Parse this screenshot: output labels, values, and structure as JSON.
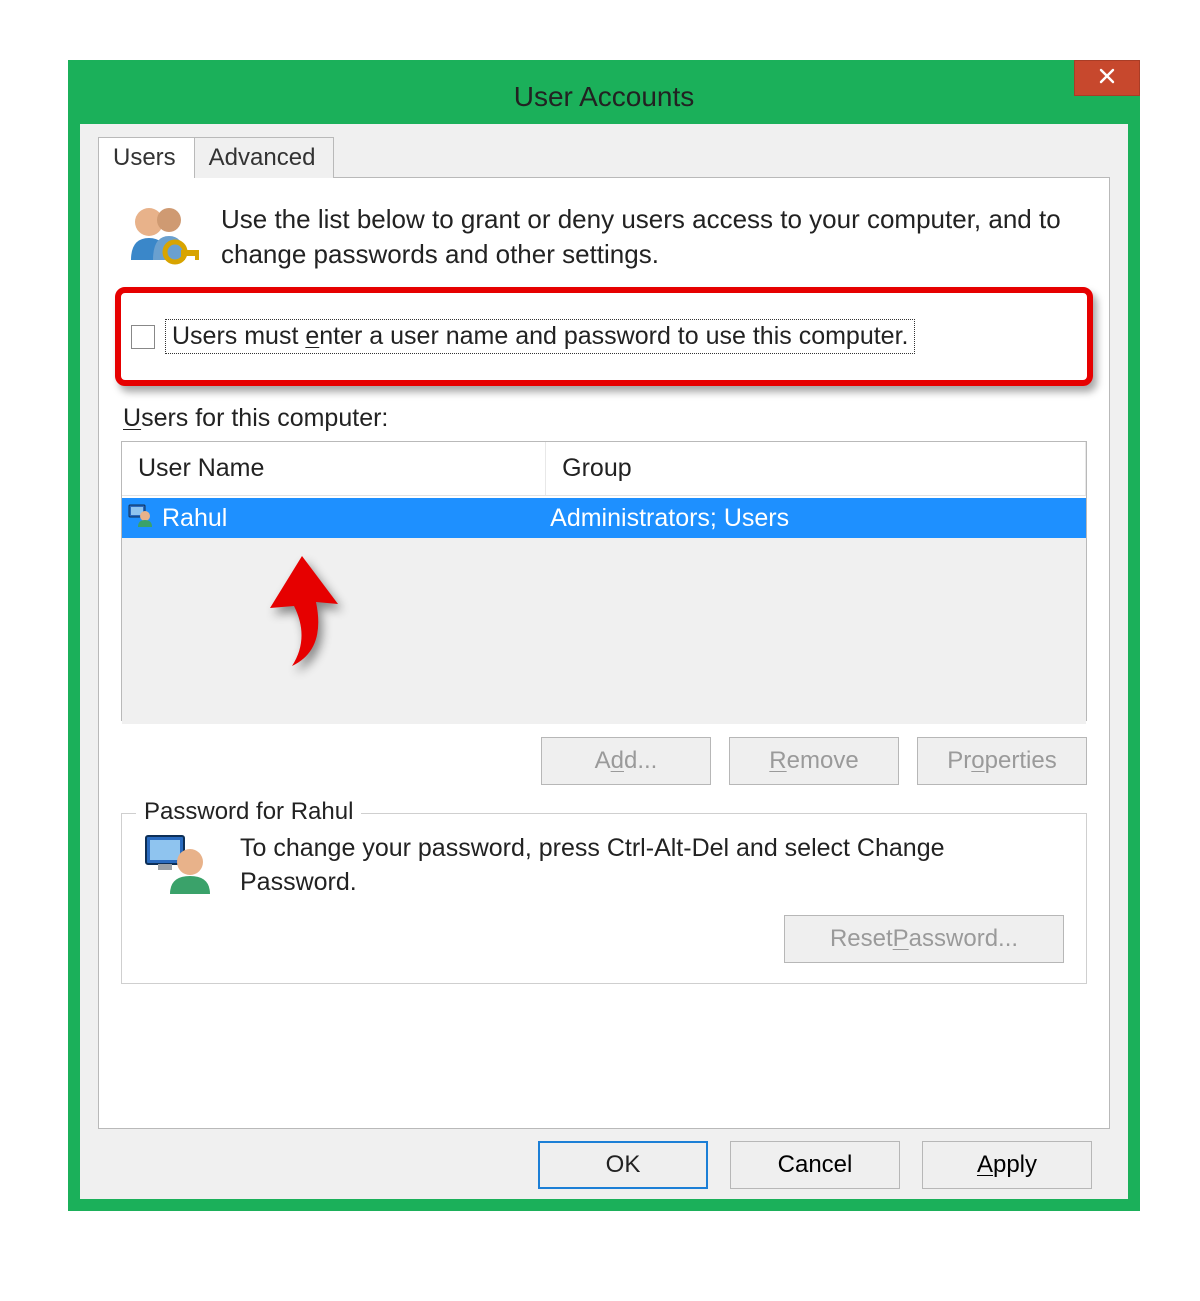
{
  "window": {
    "title": "User Accounts"
  },
  "tabs": {
    "users": "Users",
    "advanced": "Advanced"
  },
  "intro": "Use the list below to grant or deny users access to your computer, and to change passwords and other settings.",
  "checkbox": {
    "label_pre": "Users must ",
    "label_u": "e",
    "label_mid": "nter a user name and password to use this computer."
  },
  "list": {
    "label_u": "U",
    "label_rest": "sers for this computer:",
    "headers": {
      "user": "User Name",
      "group": "Group"
    },
    "rows": [
      {
        "user": "Rahul",
        "group": "Administrators; Users"
      }
    ]
  },
  "buttons": {
    "add_pre": "A",
    "add_u": "d",
    "add_post": "d...",
    "remove_u": "R",
    "remove_post": "emove",
    "properties_pre": "Pr",
    "properties_u": "o",
    "properties_post": "perties",
    "reset_pre": "Reset ",
    "reset_u": "P",
    "reset_post": "assword...",
    "ok": "OK",
    "cancel": "Cancel",
    "apply_u": "A",
    "apply_post": "pply"
  },
  "password_group": {
    "legend": "Password for Rahul",
    "text": "To change your password, press Ctrl-Alt-Del and select Change Password."
  }
}
